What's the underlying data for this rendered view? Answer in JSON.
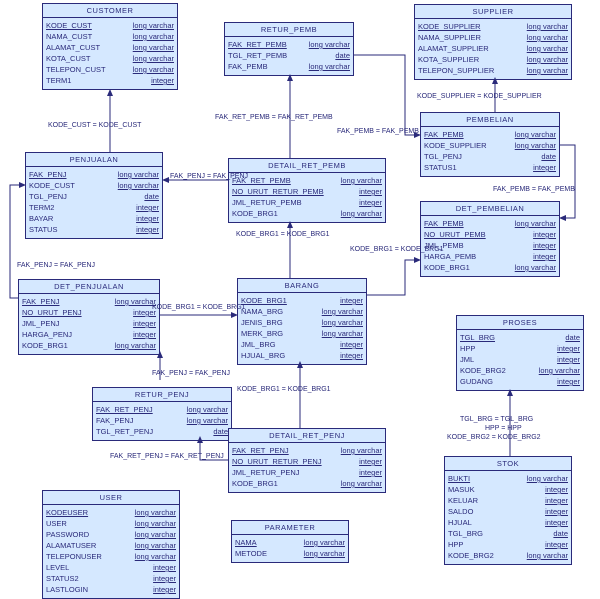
{
  "entities": {
    "customer": {
      "title": "CUSTOMER",
      "fields": [
        {
          "n": "KODE_CUST",
          "t": "long varchar",
          "key": true
        },
        {
          "n": "NAMA_CUST",
          "t": "long varchar"
        },
        {
          "n": "ALAMAT_CUST",
          "t": "long varchar"
        },
        {
          "n": "KOTA_CUST",
          "t": "long varchar"
        },
        {
          "n": "TELEPON_CUST",
          "t": "long varchar"
        },
        {
          "n": "TERM1",
          "t": "integer"
        }
      ]
    },
    "retur_pemb": {
      "title": "RETUR_PEMB",
      "fields": [
        {
          "n": "FAK_RET_PEMB",
          "t": "long varchar",
          "key": true
        },
        {
          "n": "TGL_RET_PEMB",
          "t": "date"
        },
        {
          "n": "FAK_PEMB",
          "t": "long varchar"
        }
      ]
    },
    "supplier": {
      "title": "SUPPLIER",
      "fields": [
        {
          "n": "KODE_SUPPLIER",
          "t": "long varchar",
          "key": true
        },
        {
          "n": "NAMA_SUPPLIER",
          "t": "long varchar"
        },
        {
          "n": "ALAMAT_SUPPLIER",
          "t": "long varchar"
        },
        {
          "n": "KOTA_SUPPLIER",
          "t": "long varchar"
        },
        {
          "n": "TELEPON_SUPPLIER",
          "t": "long varchar"
        }
      ]
    },
    "pembelian": {
      "title": "PEMBELIAN",
      "fields": [
        {
          "n": "FAK_PEMB",
          "t": "long varchar",
          "key": true
        },
        {
          "n": "KODE_SUPPLIER",
          "t": "long varchar"
        },
        {
          "n": "TGL_PENJ",
          "t": "date"
        },
        {
          "n": "STATUS1",
          "t": "integer"
        }
      ]
    },
    "penjualan": {
      "title": "PENJUALAN",
      "fields": [
        {
          "n": "FAK_PENJ",
          "t": "long varchar",
          "key": true
        },
        {
          "n": "KODE_CUST",
          "t": "long varchar"
        },
        {
          "n": "TGL_PENJ",
          "t": "date"
        },
        {
          "n": "TERM2",
          "t": "integer"
        },
        {
          "n": "BAYAR",
          "t": "integer"
        },
        {
          "n": "STATUS",
          "t": "integer"
        }
      ]
    },
    "detail_ret_pemb": {
      "title": "DETAIL_RET_PEMB",
      "fields": [
        {
          "n": "FAK_RET_PEMB",
          "t": "long varchar",
          "key": true
        },
        {
          "n": "NO_URUT_RETUR_PEMB",
          "t": "integer",
          "key": true
        },
        {
          "n": "JML_RETUR_PEMB",
          "t": "integer"
        },
        {
          "n": "KODE_BRG1",
          "t": "long varchar"
        }
      ]
    },
    "det_pembelian": {
      "title": "DET_PEMBELIAN",
      "fields": [
        {
          "n": "FAK_PEMB",
          "t": "long varchar",
          "key": true
        },
        {
          "n": "NO_URUT_PEMB",
          "t": "integer",
          "key": true
        },
        {
          "n": "JML_PEMB",
          "t": "integer"
        },
        {
          "n": "HARGA_PEMB",
          "t": "integer"
        },
        {
          "n": "KODE_BRG1",
          "t": "long varchar"
        }
      ]
    },
    "det_penjualan": {
      "title": "DET_PENJUALAN",
      "fields": [
        {
          "n": "FAK_PENJ",
          "t": "long varchar",
          "key": true
        },
        {
          "n": "NO_URUT_PENJ",
          "t": "integer",
          "key": true
        },
        {
          "n": "JML_PENJ",
          "t": "integer"
        },
        {
          "n": "HARGA_PENJ",
          "t": "integer"
        },
        {
          "n": "KODE_BRG1",
          "t": "long varchar"
        }
      ]
    },
    "barang": {
      "title": "BARANG",
      "fields": [
        {
          "n": "KODE_BRG1",
          "t": "integer",
          "key": true
        },
        {
          "n": "NAMA_BRG",
          "t": "long varchar"
        },
        {
          "n": "JENIS_BRG",
          "t": "long varchar"
        },
        {
          "n": "MERK_BRG",
          "t": "long varchar"
        },
        {
          "n": "JML_BRG",
          "t": "integer"
        },
        {
          "n": "HJUAL_BRG",
          "t": "integer"
        }
      ]
    },
    "proses": {
      "title": "PROSES",
      "fields": [
        {
          "n": "TGL_BRG",
          "t": "date",
          "key": true
        },
        {
          "n": "HPP",
          "t": "integer"
        },
        {
          "n": "JML",
          "t": "integer"
        },
        {
          "n": "KODE_BRG2",
          "t": "long varchar"
        },
        {
          "n": "GUDANG",
          "t": "integer"
        }
      ]
    },
    "retur_penj": {
      "title": "RETUR_PENJ",
      "fields": [
        {
          "n": "FAK_RET_PENJ",
          "t": "long varchar",
          "key": true
        },
        {
          "n": "FAK_PENJ",
          "t": "long varchar"
        },
        {
          "n": "TGL_RET_PENJ",
          "t": "date"
        }
      ]
    },
    "detail_ret_penj": {
      "title": "DETAIL_RET_PENJ",
      "fields": [
        {
          "n": "FAK_RET_PENJ",
          "t": "long varchar",
          "key": true
        },
        {
          "n": "NO_URUT_RETUR_PENJ",
          "t": "integer",
          "key": true
        },
        {
          "n": "JML_RETUR_PENJ",
          "t": "integer"
        },
        {
          "n": "KODE_BRG1",
          "t": "long varchar"
        }
      ]
    },
    "stok": {
      "title": "STOK",
      "fields": [
        {
          "n": "BUKTI",
          "t": "long varchar",
          "key": true
        },
        {
          "n": "MASUK",
          "t": "integer"
        },
        {
          "n": "KELUAR",
          "t": "integer"
        },
        {
          "n": "SALDO",
          "t": "integer"
        },
        {
          "n": "HJUAL",
          "t": "integer"
        },
        {
          "n": "TGL_BRG",
          "t": "date"
        },
        {
          "n": "HPP",
          "t": "integer"
        },
        {
          "n": "KODE_BRG2",
          "t": "long varchar"
        }
      ]
    },
    "user": {
      "title": "USER",
      "fields": [
        {
          "n": "KODEUSER",
          "t": "long varchar",
          "key": true
        },
        {
          "n": "USER",
          "t": "long varchar"
        },
        {
          "n": "PASSWORD",
          "t": "long varchar"
        },
        {
          "n": "ALAMATUSER",
          "t": "long varchar"
        },
        {
          "n": "TELEPONUSER",
          "t": "long varchar"
        },
        {
          "n": "LEVEL",
          "t": "integer"
        },
        {
          "n": "STATUS2",
          "t": "integer"
        },
        {
          "n": "LASTLOGIN",
          "t": "integer"
        }
      ]
    },
    "parameter": {
      "title": "PARAMETER",
      "fields": [
        {
          "n": "NAMA",
          "t": "long varchar",
          "key": true
        },
        {
          "n": "METODE",
          "t": "long varchar"
        }
      ]
    }
  },
  "relations": {
    "r_cust_penj": "KODE_CUST = KODE_CUST",
    "r_retpemb_drp": "FAK_RET_PEMB = FAK_RET_PEMB",
    "r_sup_pemb": "KODE_SUPPLIER = KODE_SUPPLIER",
    "r_pemb_retpemb": "FAK_PEMB = FAK_PEMB",
    "r_pemb_detpemb": "FAK_PEMB = FAK_PEMB",
    "r_penj_detpenj": "FAK_PENJ = FAK_PENJ",
    "r_penj_drp": "FAK_PENJ = FAK_PENJ",
    "r_drp_brg": "KODE_BRG1 = KODE_BRG1",
    "r_detpemb_brg": "KODE_BRG1 = KODE_BRG1",
    "r_detpenj_brg": "KODE_BRG1 = KODE_BRG1",
    "r_retpenj_drpenj": "FAK_RET_PENJ = FAK_RET_PENJ",
    "r_drpenj_brg": "KODE_BRG1 = KODE_BRG1",
    "r_proses_stok1": "TGL_BRG = TGL_BRG",
    "r_proses_stok2": "HPP = HPP",
    "r_proses_stok3": "KODE_BRG2 = KODE_BRG2",
    "r_retpenj_penj": "FAK_PENJ = FAK_PENJ"
  }
}
